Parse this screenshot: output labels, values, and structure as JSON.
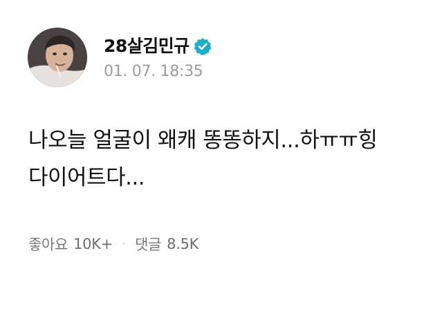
{
  "post": {
    "author": {
      "name": "28살김민규",
      "avatar": "avatar-photo",
      "verified_icon": "verified-badge-icon",
      "verified_color": "#1ab0c9"
    },
    "timestamp": "01. 07. 18:35",
    "body_lines": [
      "나오늘 얼굴이 왜캐 똥똥하지...하ㅠㅠ힝",
      "다이어트다..."
    ],
    "stats": {
      "likes_label": "좋아요",
      "likes_value": "10K+",
      "separator": "·",
      "comments_label": "댓글",
      "comments_value": "8.5K"
    }
  }
}
